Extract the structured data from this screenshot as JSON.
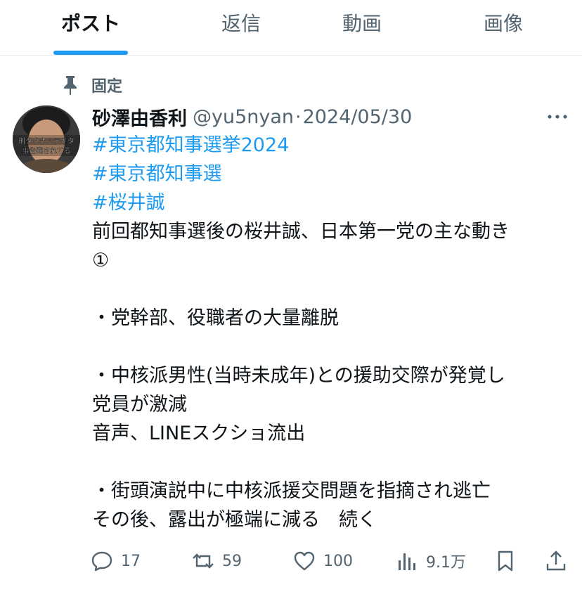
{
  "tabs": [
    {
      "label": "ポスト",
      "active": true
    },
    {
      "label": "返信",
      "active": false
    },
    {
      "label": "動画",
      "active": false
    },
    {
      "label": "画像",
      "active": false
    }
  ],
  "pinned": {
    "label": "固定"
  },
  "avatar": {
    "overlay_lines": [
      "刑タクナッテキタ",
      "事告発されてる"
    ]
  },
  "post": {
    "author_name": "砂澤由香利",
    "handle": "@yu5nyan",
    "separator": "·",
    "date": "2024/05/30",
    "hashtags": [
      "#東京都知事選挙2024",
      "#東京都知事選",
      "#桜井誠"
    ],
    "lines": [
      "前回都知事選後の桜井誠、日本第一党の主な動き",
      "①",
      "",
      "・党幹部、役職者の大量離脱",
      "",
      "・中核派男性(当時未成年)との援助交際が発覚し",
      "党員が激減",
      "音声、LINEスクショ流出",
      "",
      "・街頭演説中に中核派援交問題を指摘され逃亡",
      "その後、露出が極端に減る　続く"
    ]
  },
  "actions": {
    "reply": {
      "icon": "reply-icon",
      "count": "17"
    },
    "repost": {
      "icon": "repost-icon",
      "count": "59"
    },
    "like": {
      "icon": "heart-icon",
      "count": "100"
    },
    "views": {
      "icon": "views-icon",
      "count": "9.1万"
    },
    "bookmark": {
      "icon": "bookmark-icon"
    },
    "share": {
      "icon": "share-icon"
    }
  },
  "colors": {
    "accent": "#1d9bf0",
    "secondary_text": "#536471",
    "primary_text": "#0f1419"
  }
}
